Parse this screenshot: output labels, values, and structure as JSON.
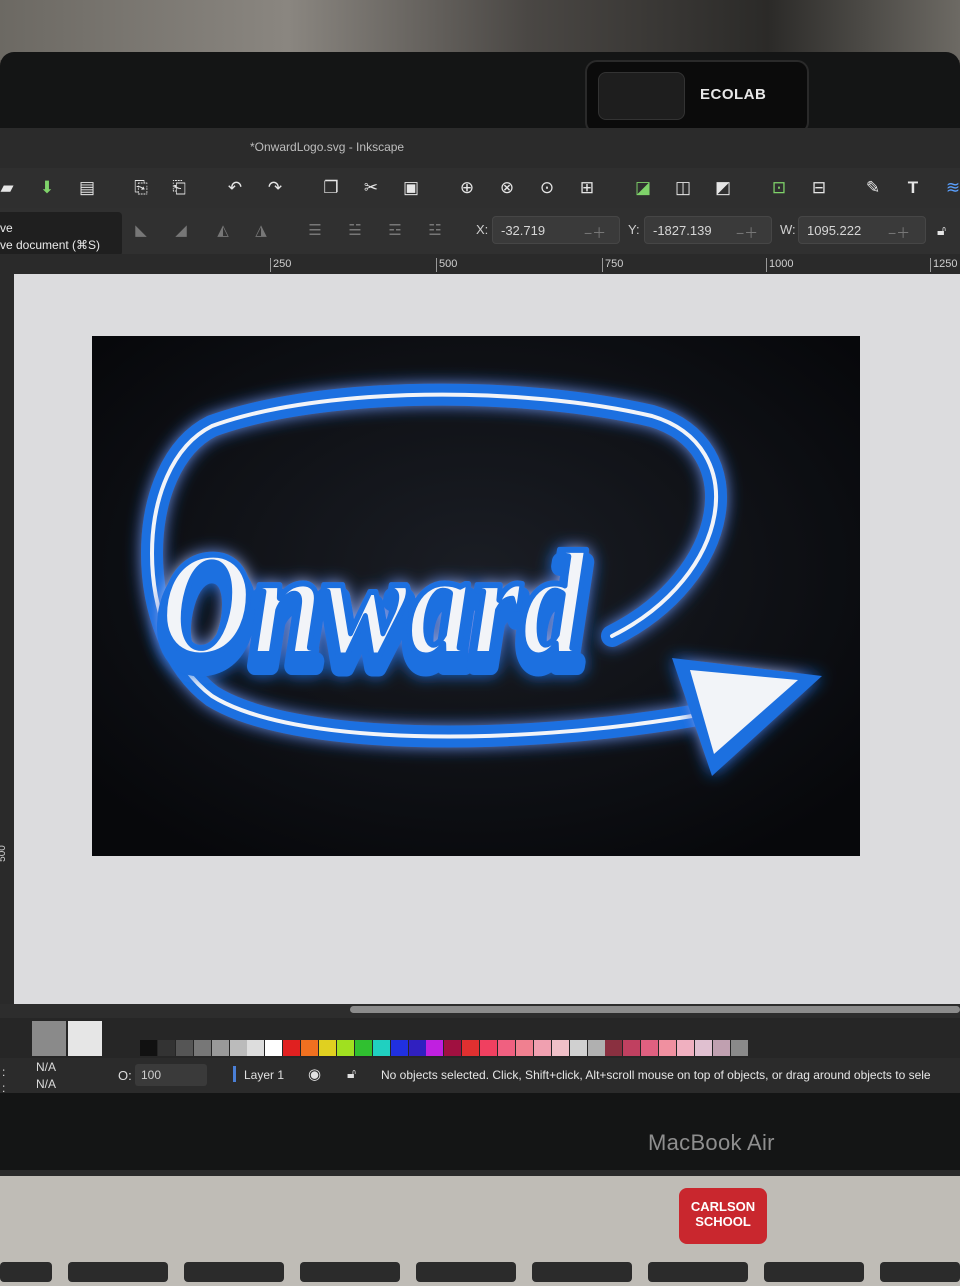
{
  "window": {
    "title": "*OnwardLogo.svg - Inkscape"
  },
  "toolbar": {
    "icons": [
      "open-icon",
      "save-icon",
      "print-icon",
      "import-icon",
      "export-icon",
      "undo-icon",
      "redo-icon",
      "copy-icon",
      "cut-icon",
      "paste-icon",
      "zoom-selection-icon",
      "zoom-drawing-icon",
      "zoom-page-icon",
      "zoom-fit-icon",
      "duplicate-icon",
      "clone-icon",
      "unlink-clone-icon",
      "group-icon",
      "ungroup-icon",
      "fill-stroke-icon",
      "text-icon",
      "layers-icon"
    ]
  },
  "tooltip": {
    "title": "ve",
    "description": "ve document (⌘S)"
  },
  "coords": {
    "x_label": "X:",
    "x_value": "-32.719",
    "y_label": "Y:",
    "y_value": "-1827.139",
    "w_label": "W:",
    "w_value": "1095.222"
  },
  "ruler": {
    "ticks": [
      "250",
      "500",
      "750",
      "1000",
      "1250"
    ],
    "vertical_label": "500"
  },
  "artwork": {
    "logo_text": "Onward"
  },
  "colors": {
    "logo_blue": "#1f6fe0",
    "arrow_fill": "#f2f4f8",
    "page_background": "#0d0f14",
    "palette": [
      "#111111",
      "#333333",
      "#555555",
      "#777777",
      "#999999",
      "#bbbbbb",
      "#dddddd",
      "#ffffff",
      "#e02020",
      "#f07020",
      "#e0d020",
      "#a0e020",
      "#30c030",
      "#20d0c0",
      "#2030e0",
      "#3020c0",
      "#c020e0",
      "#a01040",
      "#e03030",
      "#f04060",
      "#f06080",
      "#f08090",
      "#f0a0b0",
      "#f0c0c8",
      "#d0d0d0",
      "#b0b0b0",
      "#8a3040",
      "#c04060",
      "#e06080",
      "#f090a0",
      "#f0b0c0",
      "#e0c0d0",
      "#c0a0b0",
      "#8a8a8a"
    ]
  },
  "status": {
    "fill_label": ":",
    "fill_value": "N/A",
    "stroke_label": ":",
    "stroke_value": "N/A",
    "opacity_label": "O:",
    "opacity_value": "100",
    "layer_name": "Layer 1",
    "message": "No objects selected. Click, Shift+click, Alt+scroll mouse on top of objects, or drag around objects to sele"
  },
  "hardware": {
    "webcam_cover_brand": "ECOLAB",
    "laptop_label": "MacBook Air",
    "sticker_line1": "CARLSON",
    "sticker_line2": "SCHOOL"
  }
}
